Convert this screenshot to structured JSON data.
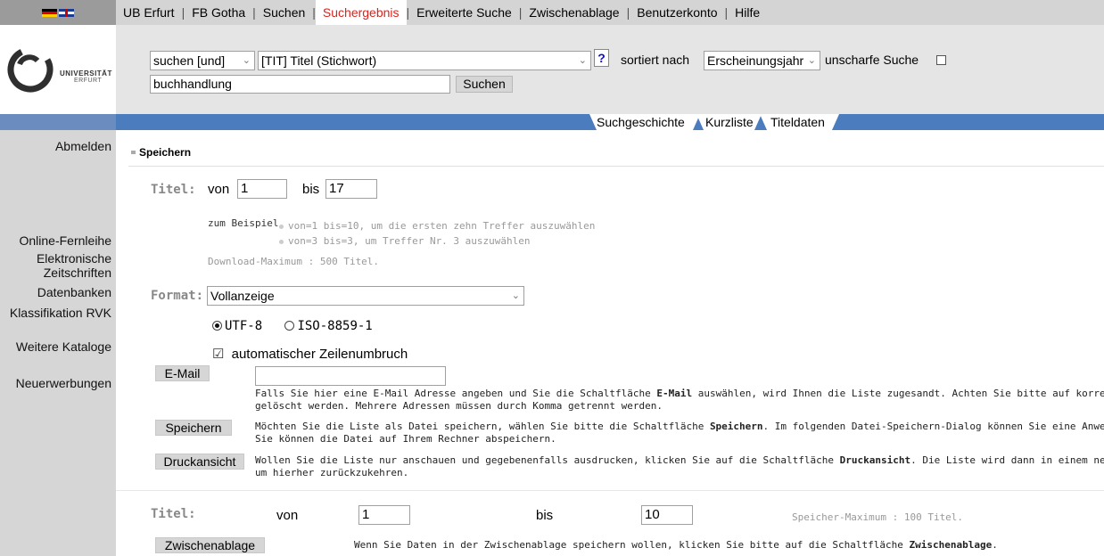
{
  "topnav": {
    "items": [
      {
        "label": "UB Erfurt"
      },
      {
        "label": "FB Gotha"
      },
      {
        "label": "Suchen"
      },
      {
        "label": "Suchergebnis"
      },
      {
        "label": "Erweiterte Suche"
      },
      {
        "label": "Zwischenablage"
      },
      {
        "label": "Benutzerkonto"
      },
      {
        "label": "Hilfe"
      }
    ],
    "separator": "|",
    "active_item": "Suchergebnis",
    "active_color": "#d9241e"
  },
  "logo": {
    "line1": "UNIVERSITÄT",
    "line2": "ERFURT"
  },
  "search": {
    "operator": "suchen [und]",
    "field": "[TIT] Titel (Stichwort)",
    "help": "?",
    "sort_label": "sortiert nach",
    "sort_value": "Erscheinungsjahr",
    "fuzzy_label": "unscharfe Suche",
    "fuzzy_checked": false,
    "query": "buchhandlung",
    "submit": "Suchen"
  },
  "tabs": [
    {
      "label": "Suchgeschichte"
    },
    {
      "label": "Kurzliste"
    },
    {
      "label": "Titeldaten"
    }
  ],
  "sidebar": {
    "logout": "Abmelden",
    "ill": "Online-Fernleihe",
    "ejournals_1": "Elektronische",
    "ejournals_2": "Zeitschriften",
    "databases": "Datenbanken",
    "rvk": "Klassifikation RVK",
    "catalogs": "Weitere Kataloge",
    "acquisitions": "Neuerwerbungen"
  },
  "save": {
    "heading": "Speichern",
    "title_label": "Titel:",
    "from_label": "von",
    "from_value": "1",
    "to_label": "bis",
    "to_value": "17",
    "example_label": "zum Beispiel",
    "example_1": "von=1 bis=10, um die ersten zehn Treffer auszuwählen",
    "example_2": "von=3 bis=3, um Treffer Nr. 3 auszuwählen",
    "download_max": "Download-Maximum : 500 Titel.",
    "format_label": "Format:",
    "format_value": "Vollanzeige",
    "enc_utf8": "UTF-8",
    "enc_iso": "ISO-8859-1",
    "enc_selected": "UTF-8",
    "wrap_label": "automatischer Zeilenumbruch",
    "wrap_checked": true,
    "email_button": "E-Mail",
    "email_value": "",
    "email_desc_1": "Falls Sie hier eine E-Mail Adresse angeben und Sie die Schaltfläche ",
    "email_desc_bold": "E-Mail",
    "email_desc_2": " auswählen, wird Ihnen die Liste zugesandt. Achten Sie bitte auf korrekte Schreibweise, da r",
    "email_desc_line2": "gelöscht werden. Mehrere Adressen müssen durch Komma getrennt werden.",
    "save_button": "Speichern",
    "save_desc_1": "Möchten Sie die Liste als Datei speichern, wählen Sie bitte die Schaltfläche ",
    "save_desc_bold": "Speichern",
    "save_desc_2": ". Im folgenden Datei-Speichern-Dialog können Sie eine Anwendung auswählen, i",
    "save_desc_line2": "Sie können die Datei auf Ihrem Rechner abspeichern.",
    "print_button": "Druckansicht",
    "print_desc_1": "Wollen Sie die Liste nur anschauen und gegebenenfalls ausdrucken, klicken Sie auf die Schaltfläche ",
    "print_desc_bold": "Druckansicht",
    "print_desc_2": ". Die Liste wird dann in einem neuen Fenster angeze",
    "print_desc_line2": "um hierher zurückzukehren."
  },
  "clipboard": {
    "title_label": "Titel:",
    "from_label": "von",
    "from_value": "1",
    "to_label": "bis",
    "to_value": "10",
    "save_max": "Speicher-Maximum : 100 Titel.",
    "button": "Zwischenablage",
    "desc_1": "Wenn Sie Daten in der Zwischenablage speichern wollen, klicken Sie bitte auf die Schaltfläche ",
    "desc_bold": "Zwischenablage",
    "desc_2": "."
  }
}
